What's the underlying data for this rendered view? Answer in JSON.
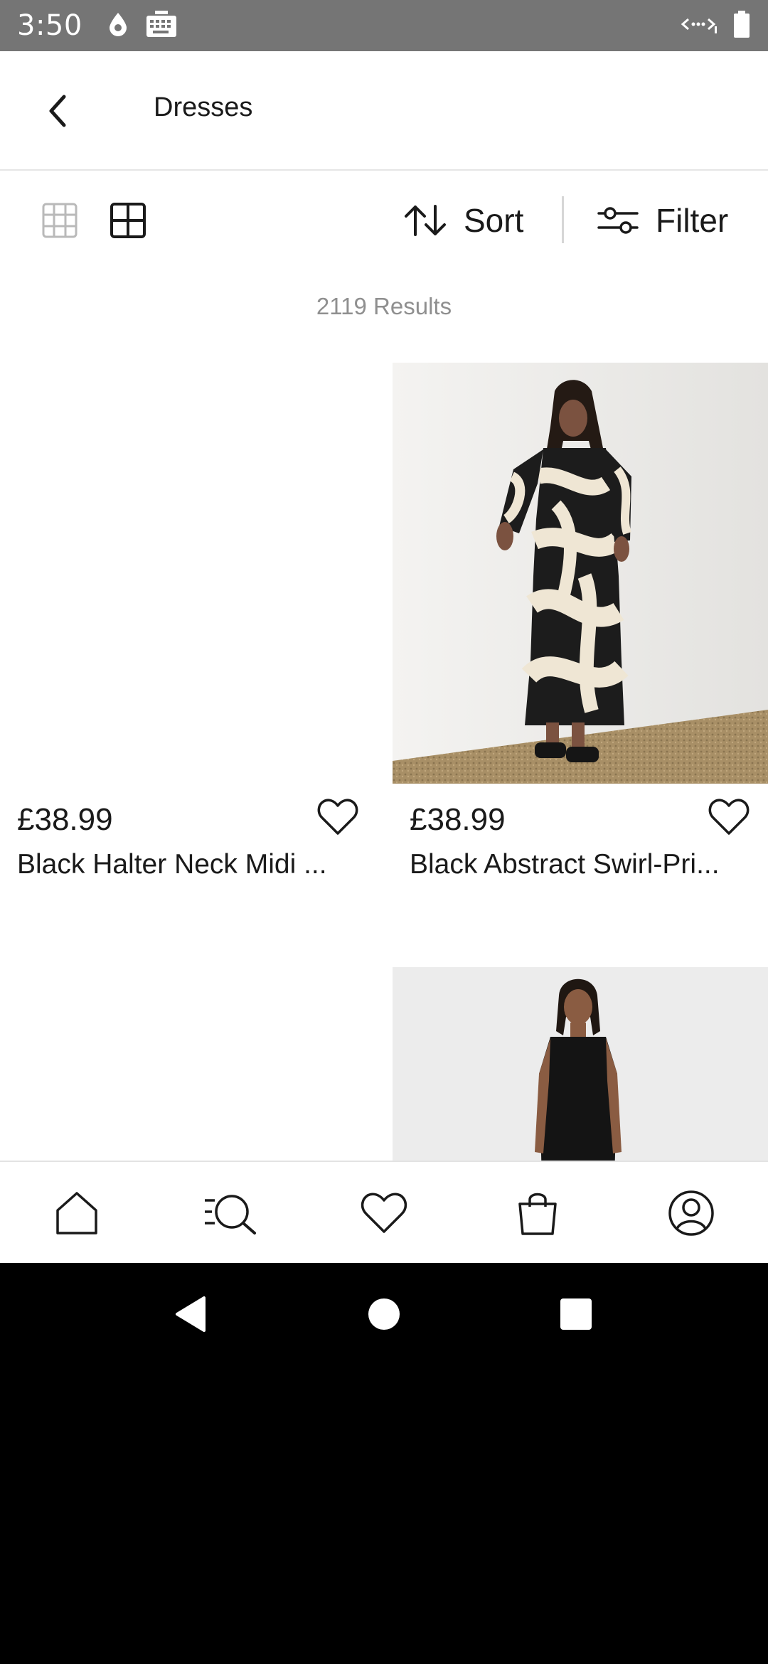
{
  "status_bar": {
    "time": "3:50",
    "left_icons": [
      "drop-icon",
      "keyboard-icon"
    ],
    "right_icons": [
      "data-saver-icon",
      "battery-icon"
    ]
  },
  "header": {
    "title": "Dresses",
    "back_icon": "back-arrow-icon"
  },
  "toolbar": {
    "grid_views": [
      "small-grid-icon",
      "large-grid-icon"
    ],
    "sort_label": "Sort",
    "filter_label": "Filter"
  },
  "results_text": "2119 Results",
  "products": [
    {
      "price": "£38.99",
      "name": "Black Halter Neck Midi ...",
      "image": "blank"
    },
    {
      "price": "£38.99",
      "name": "Black Abstract Swirl-Pri...",
      "image": "model-swirl-print-dress"
    },
    {
      "price": "",
      "name": "",
      "image": "blank"
    },
    {
      "price": "",
      "name": "",
      "image": "model-black-sleeveless-dress"
    }
  ],
  "bottom_nav": [
    "home-icon",
    "search-icon",
    "heart-icon",
    "bag-icon",
    "account-icon"
  ],
  "system_nav": [
    "back-triangle-icon",
    "home-circle-icon",
    "recents-square-icon"
  ],
  "colors": {
    "status_bar": "#757575",
    "text": "#1a1a1a",
    "muted": "#8f8f8f"
  }
}
